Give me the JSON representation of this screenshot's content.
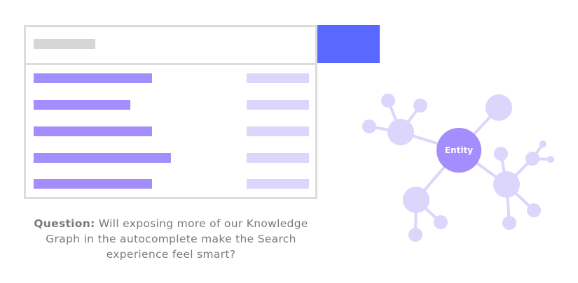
{
  "question": {
    "label": "Question:",
    "text": "Will exposing more of our Knowledge Graph in the autocomplete make the Search experience feel smart?"
  },
  "graph": {
    "center_label": "Entity"
  },
  "colors": {
    "primary": "#a48dfc",
    "light": "#dcd5fc",
    "button": "#5968ff",
    "border": "#dcdcdc"
  }
}
